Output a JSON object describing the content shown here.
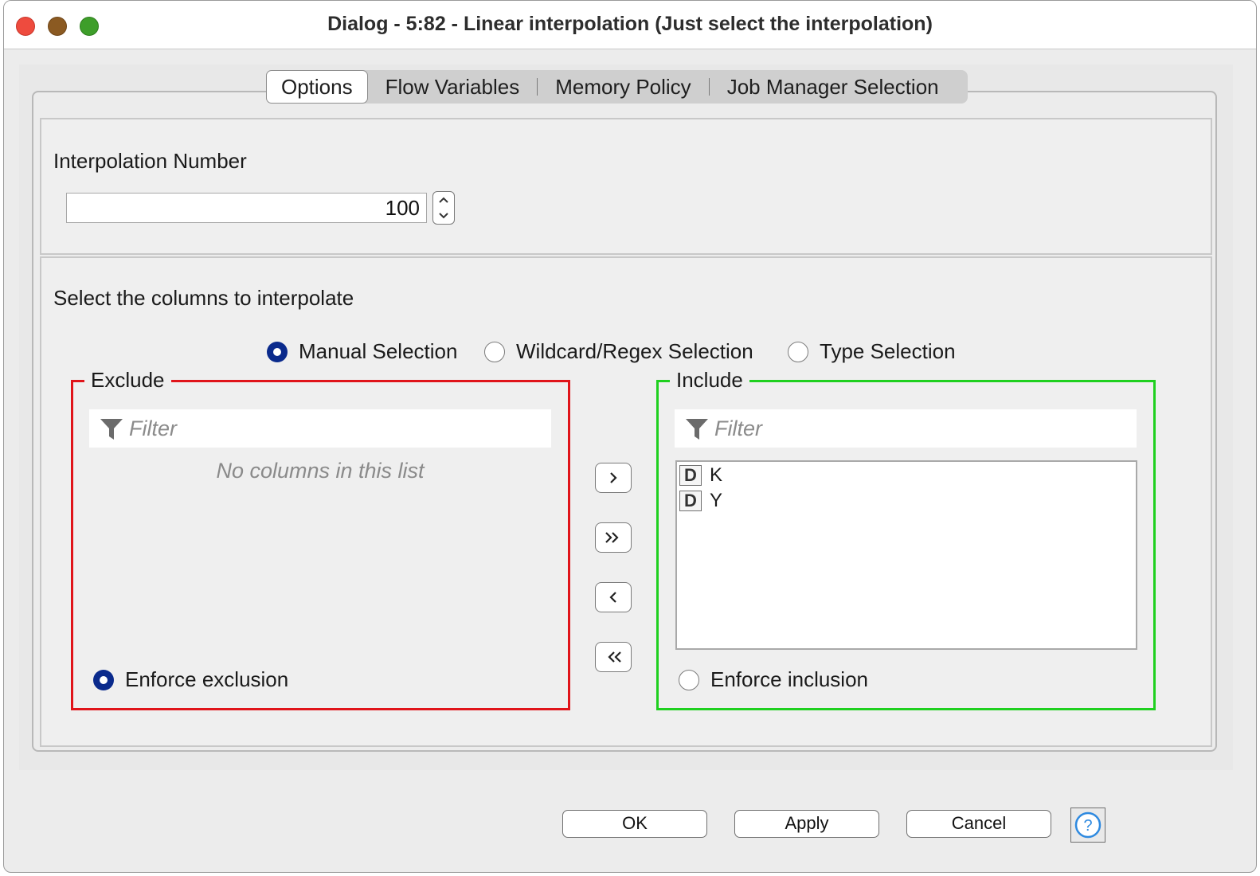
{
  "window": {
    "title": "Dialog - 5:82 - Linear interpolation (Just select the interpolation)"
  },
  "tabs": [
    {
      "label": "Options",
      "active": true
    },
    {
      "label": "Flow Variables",
      "active": false
    },
    {
      "label": "Memory Policy",
      "active": false
    },
    {
      "label": "Job Manager Selection",
      "active": false
    }
  ],
  "interpolation": {
    "label": "Interpolation Number",
    "value": "100"
  },
  "columns": {
    "label": "Select the columns to interpolate",
    "modes": [
      {
        "label": "Manual Selection",
        "selected": true
      },
      {
        "label": "Wildcard/Regex Selection",
        "selected": false
      },
      {
        "label": "Type Selection",
        "selected": false
      }
    ],
    "exclude": {
      "title": "Exclude",
      "filter_placeholder": "Filter",
      "empty_message": "No columns in this list",
      "enforce_label": "Enforce exclusion",
      "enforce_selected": true
    },
    "include": {
      "title": "Include",
      "filter_placeholder": "Filter",
      "items": [
        {
          "type": "D",
          "name": "K"
        },
        {
          "type": "D",
          "name": "Y"
        }
      ],
      "enforce_label": "Enforce inclusion",
      "enforce_selected": false
    }
  },
  "buttons": {
    "ok": "OK",
    "apply": "Apply",
    "cancel": "Cancel",
    "help": "?"
  },
  "colors": {
    "exclude_border": "#e0141a",
    "include_border": "#1fd01f",
    "radio_selected": "#0a2a8c",
    "help_icon": "#2f8ae0"
  },
  "icons": {
    "move_right": "chevron-right-icon",
    "move_all_right": "double-chevron-right-icon",
    "move_left": "chevron-left-icon",
    "move_all_left": "double-chevron-left-icon",
    "filter": "filter-funnel-icon"
  }
}
